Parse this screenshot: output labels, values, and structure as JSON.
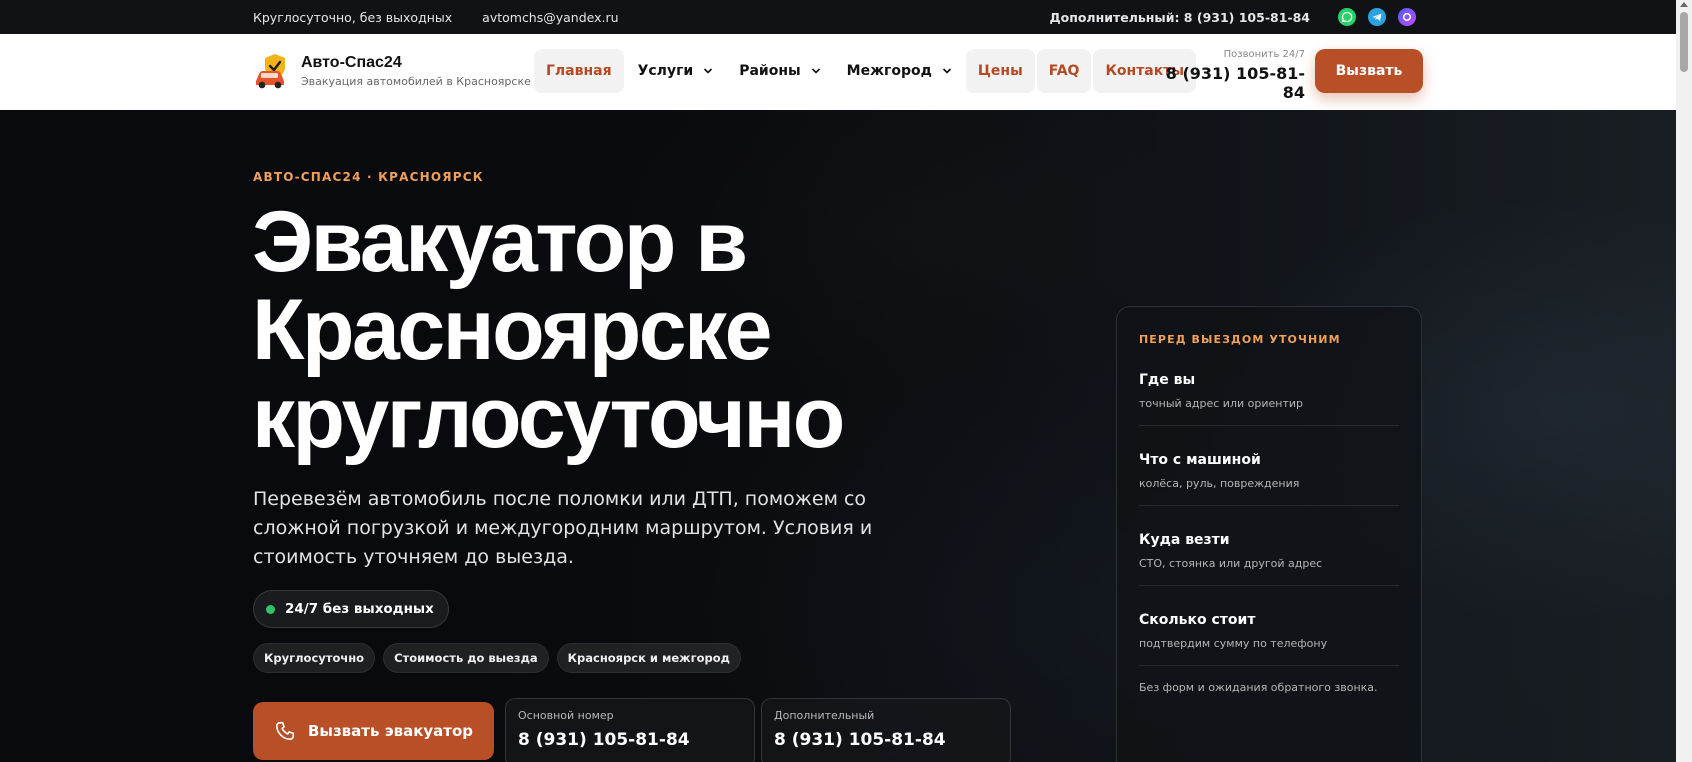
{
  "topbar": {
    "hours": "Круглосуточно, без выходных",
    "email": "avtomchs@yandex.ru",
    "extra_phone": "Дополнительный: 8 (931) 105-81-84"
  },
  "header": {
    "brand": "Авто-Спас24",
    "tagline": "Эвакуация автомобилей в Красноярске",
    "nav": [
      {
        "label": "Главная",
        "dropdown": false
      },
      {
        "label": "Услуги",
        "dropdown": true
      },
      {
        "label": "Районы",
        "dropdown": true
      },
      {
        "label": "Межгород",
        "dropdown": true
      },
      {
        "label": "Цены",
        "dropdown": false
      },
      {
        "label": "FAQ",
        "dropdown": false
      },
      {
        "label": "Контакты",
        "dropdown": false
      }
    ],
    "call_caption": "Позвонить 24/7",
    "call_number": "8 (931) 105-81-84",
    "call_button": "Вызвать"
  },
  "hero": {
    "eyebrow": "АВТО-СПАС24 · КРАСНОЯРСК",
    "title_lines": [
      "Эвакуатор в",
      "Красноярске",
      "круглосуточно"
    ],
    "lead": "Перевезём автомобиль после поломки или ДТП, поможем со сложной погрузкой и междугородним маршрутом. Условия и стоимость уточняем до выезда.",
    "status": "24/7 без выходных",
    "chips": [
      "Круглосуточно",
      "Стоимость до выезда",
      "Красноярск и межгород"
    ],
    "cta": "Вызвать эвакуатор",
    "phones": [
      {
        "caption": "Основной номер",
        "number": "8 (931) 105-81-84"
      },
      {
        "caption": "Дополнительный",
        "number": "8 (931) 105-81-84"
      }
    ]
  },
  "card": {
    "heading": "ПЕРЕД ВЫЕЗДОМ УТОЧНИМ",
    "rows": [
      {
        "title": "Где вы",
        "sub": "точный адрес или ориентир"
      },
      {
        "title": "Что с машиной",
        "sub": "колёса, руль, повреждения"
      },
      {
        "title": "Куда везти",
        "sub": "СТО, стоянка или другой адрес"
      },
      {
        "title": "Сколько стоит",
        "sub": "подтвердим сумму по телефону"
      }
    ],
    "footer": "Без форм и ожидания обратного звонка."
  },
  "colors": {
    "accent": "#b84f26",
    "eyebrow": "#f1a05a",
    "status_dot": "#2fc46b",
    "header_bg": "#ffffff",
    "topbar_bg": "#111216"
  },
  "icons": {
    "whatsapp": "whatsapp-icon",
    "telegram": "telegram-icon",
    "max": "max-messenger-icon",
    "logo": "car-shield-logo",
    "phone": "phone-icon",
    "chevron": "chevron-down-icon"
  }
}
